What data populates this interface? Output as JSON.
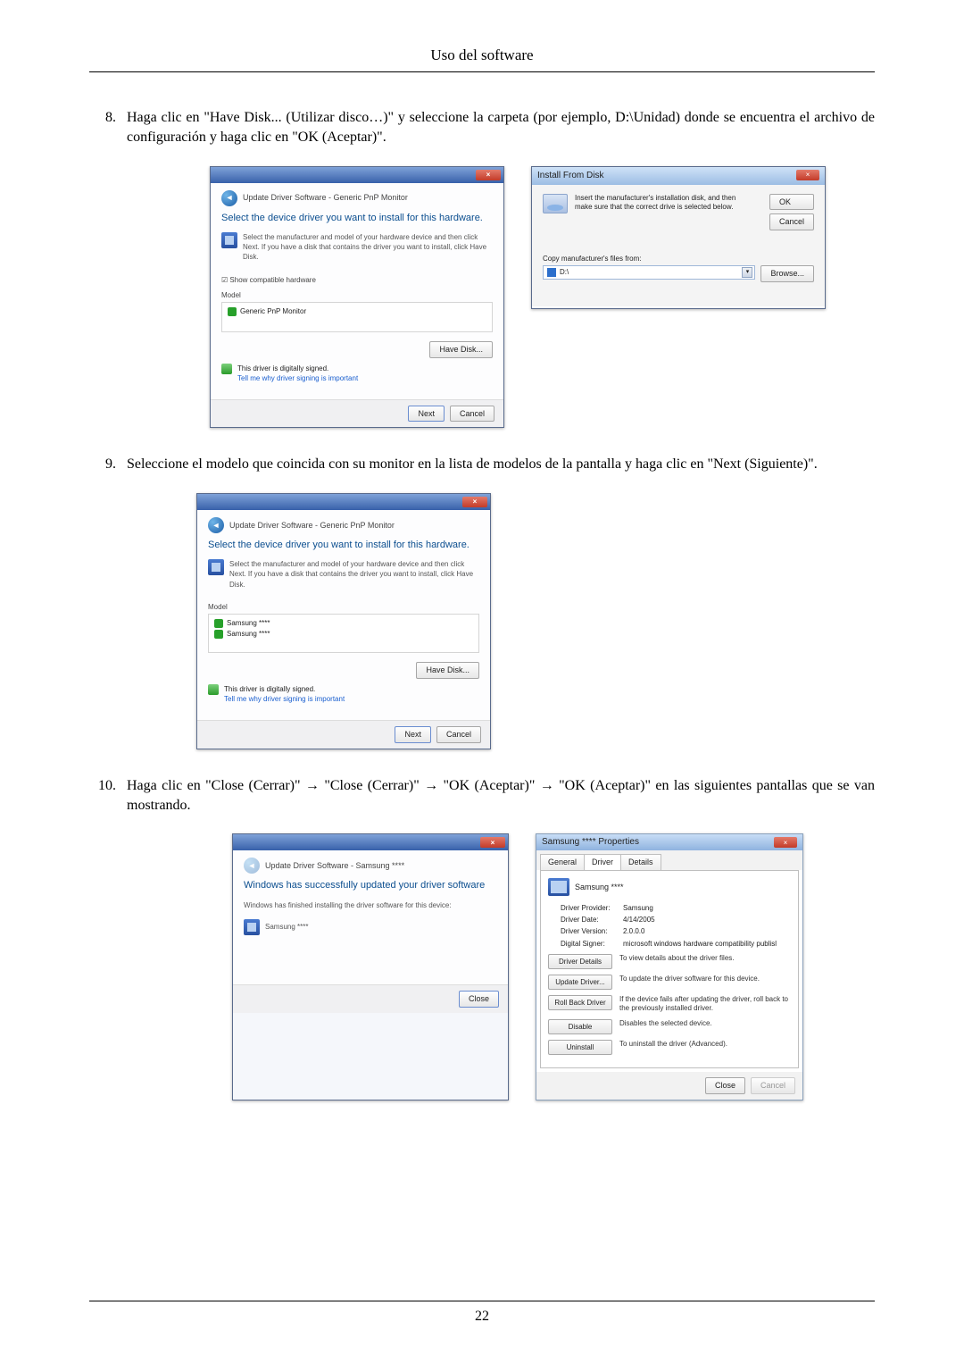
{
  "header": {
    "title": "Uso del software"
  },
  "steps": {
    "s8": {
      "num": "8.",
      "text": "Haga clic en \"Have Disk... (Utilizar disco…)\" y seleccione la carpeta (por ejemplo, D:\\Unidad) donde se encuentra el archivo de configuración y haga clic en \"OK (Aceptar)\"."
    },
    "s9": {
      "num": "9.",
      "text": "Seleccione el modelo que coincida con su monitor en la lista de modelos de la pantalla y haga clic en \"Next (Siguiente)\"."
    },
    "s10": {
      "num": "10.",
      "text": "Haga clic en \"Close (Cerrar)\" → \"Close (Cerrar)\" → \"OK (Aceptar)\" → \"OK (Aceptar)\" en las siguientes pantallas que se van mostrando."
    }
  },
  "dialog8_left": {
    "breadcrumb": "Update Driver Software - Generic PnP Monitor",
    "heading": "Select the device driver you want to install for this hardware.",
    "sub": "Select the manufacturer and model of your hardware device and then click Next. If you have a disk that contains the driver you want to install, click Have Disk.",
    "checkbox": "Show compatible hardware",
    "list_label": "Model",
    "list_item": "Generic PnP Monitor",
    "signed": "This driver is digitally signed.",
    "tell": "Tell me why driver signing is important",
    "have_disk": "Have Disk...",
    "next": "Next",
    "cancel": "Cancel"
  },
  "dialog8_right": {
    "title": "Install From Disk",
    "instr": "Insert the manufacturer's installation disk, and then make sure that the correct drive is selected below.",
    "ok": "OK",
    "cancel": "Cancel",
    "copy_label": "Copy manufacturer's files from:",
    "combo_value": "D:\\",
    "browse": "Browse..."
  },
  "dialog9": {
    "breadcrumb": "Update Driver Software - Generic PnP Monitor",
    "heading": "Select the device driver you want to install for this hardware.",
    "sub": "Select the manufacturer and model of your hardware device and then click Next. If you have a disk that contains the driver you want to install, click Have Disk.",
    "list_label": "Model",
    "item1": "Samsung ****",
    "item2": "Samsung ****",
    "signed": "This driver is digitally signed.",
    "tell": "Tell me why driver signing is important",
    "have_disk": "Have Disk...",
    "next": "Next",
    "cancel": "Cancel"
  },
  "dialog10_left": {
    "breadcrumb": "Update Driver Software - Samsung ****",
    "heading": "Windows has successfully updated your driver software",
    "sub": "Windows has finished installing the driver software for this device:",
    "device": "Samsung ****",
    "close": "Close"
  },
  "dialog10_right": {
    "title": "Samsung **** Properties",
    "tabs": {
      "general": "General",
      "driver": "Driver",
      "details": "Details"
    },
    "device": "Samsung ****",
    "kv": {
      "provider_k": "Driver Provider:",
      "provider_v": "Samsung",
      "date_k": "Driver Date:",
      "date_v": "4/14/2005",
      "version_k": "Driver Version:",
      "version_v": "2.0.0.0",
      "signer_k": "Digital Signer:",
      "signer_v": "microsoft windows hardware compatibility publisl"
    },
    "btns": {
      "details": "Driver Details",
      "details_d": "To view details about the driver files.",
      "update": "Update Driver...",
      "update_d": "To update the driver software for this device.",
      "rollback": "Roll Back Driver",
      "rollback_d": "If the device fails after updating the driver, roll back to the previously installed driver.",
      "disable": "Disable",
      "disable_d": "Disables the selected device.",
      "uninstall": "Uninstall",
      "uninstall_d": "To uninstall the driver (Advanced)."
    },
    "close": "Close",
    "cancel": "Cancel"
  },
  "page_number": "22"
}
